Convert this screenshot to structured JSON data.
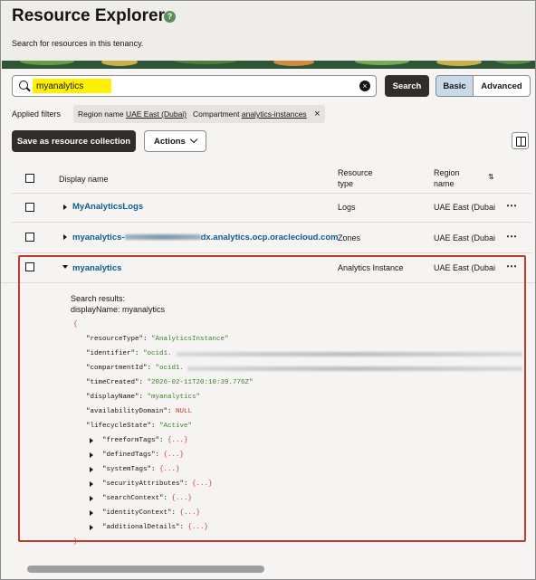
{
  "header": {
    "title": "Resource Explorer",
    "help_icon": "?",
    "subtitle": "Search for resources in this tenancy."
  },
  "search": {
    "value": "myanalytics",
    "button_label": "Search",
    "mode_basic": "Basic",
    "mode_advanced": "Advanced",
    "clear_icon": "×"
  },
  "filters": {
    "label": "Applied filters",
    "chip1_prefix": "Region name",
    "chip1_value": "UAE East (Dubai)",
    "chip2_prefix": "Compartment",
    "chip2_value": "analytics-instances",
    "chip2_remove": "×"
  },
  "toolbar": {
    "save_label": "Save as resource collection",
    "actions_label": "Actions"
  },
  "table": {
    "headers": {
      "display_name": "Display name",
      "resource_type_1": "Resource",
      "resource_type_2": "type",
      "region_1": "Region",
      "region_2": "name",
      "sort_icon": "⇅"
    },
    "rows": [
      {
        "name": "MyAnalyticsLogs",
        "type": "Logs",
        "region": "UAE East (Dubai",
        "more": "⋯"
      },
      {
        "name_start": "myanalytics-",
        "name_end": "dx.analytics.ocp.oraclecloud.com",
        "type": "Zones",
        "region": "UAE East (Dubai",
        "more": "⋯"
      },
      {
        "name": "myanalytics",
        "type": "Analytics Instance",
        "region": "UAE East (Dubai",
        "more": "⋯"
      }
    ]
  },
  "details": {
    "results_label": "Search results:",
    "query_line": "displayName: myanalytics",
    "open_brace": "{",
    "close_brace": "}",
    "fields": [
      {
        "key": "\"resourceType\": ",
        "value": "\"AnalyticsInstance\"",
        "kind": "string"
      },
      {
        "key": "\"identifier\": ",
        "value": "\"ocid1.",
        "kind": "string"
      },
      {
        "key": "\"compartmentId\": ",
        "value": "\"ocid1.",
        "kind": "string"
      },
      {
        "key": "\"timeCreated\": ",
        "value": "\"2026-02-11T20:10:39.776Z\"",
        "kind": "string"
      },
      {
        "key": "\"displayName\": ",
        "value": "\"myanalytics\"",
        "kind": "string"
      },
      {
        "key": "\"availabilityDomain\": ",
        "value": "NULL",
        "kind": "null"
      },
      {
        "key": "\"lifecycleState\": ",
        "value": "\"Active\"",
        "kind": "string"
      }
    ],
    "objects": [
      {
        "key": "\"freeformTags\": ",
        "value": "{...}"
      },
      {
        "key": "\"definedTags\": ",
        "value": "{...}"
      },
      {
        "key": "\"systemTags\": ",
        "value": "{...}"
      },
      {
        "key": "\"securityAttributes\": ",
        "value": "{...}"
      },
      {
        "key": "\"searchContext\": ",
        "value": "{...}"
      },
      {
        "key": "\"identityContext\": ",
        "value": "{...}"
      },
      {
        "key": "\"additionalDetails\": ",
        "value": "{...}"
      }
    ]
  },
  "colors": {
    "accent_dark": "#312d2a",
    "link": "#0d5d8c",
    "highlight": "#c0392b",
    "search_highlight": "#fdf000"
  }
}
